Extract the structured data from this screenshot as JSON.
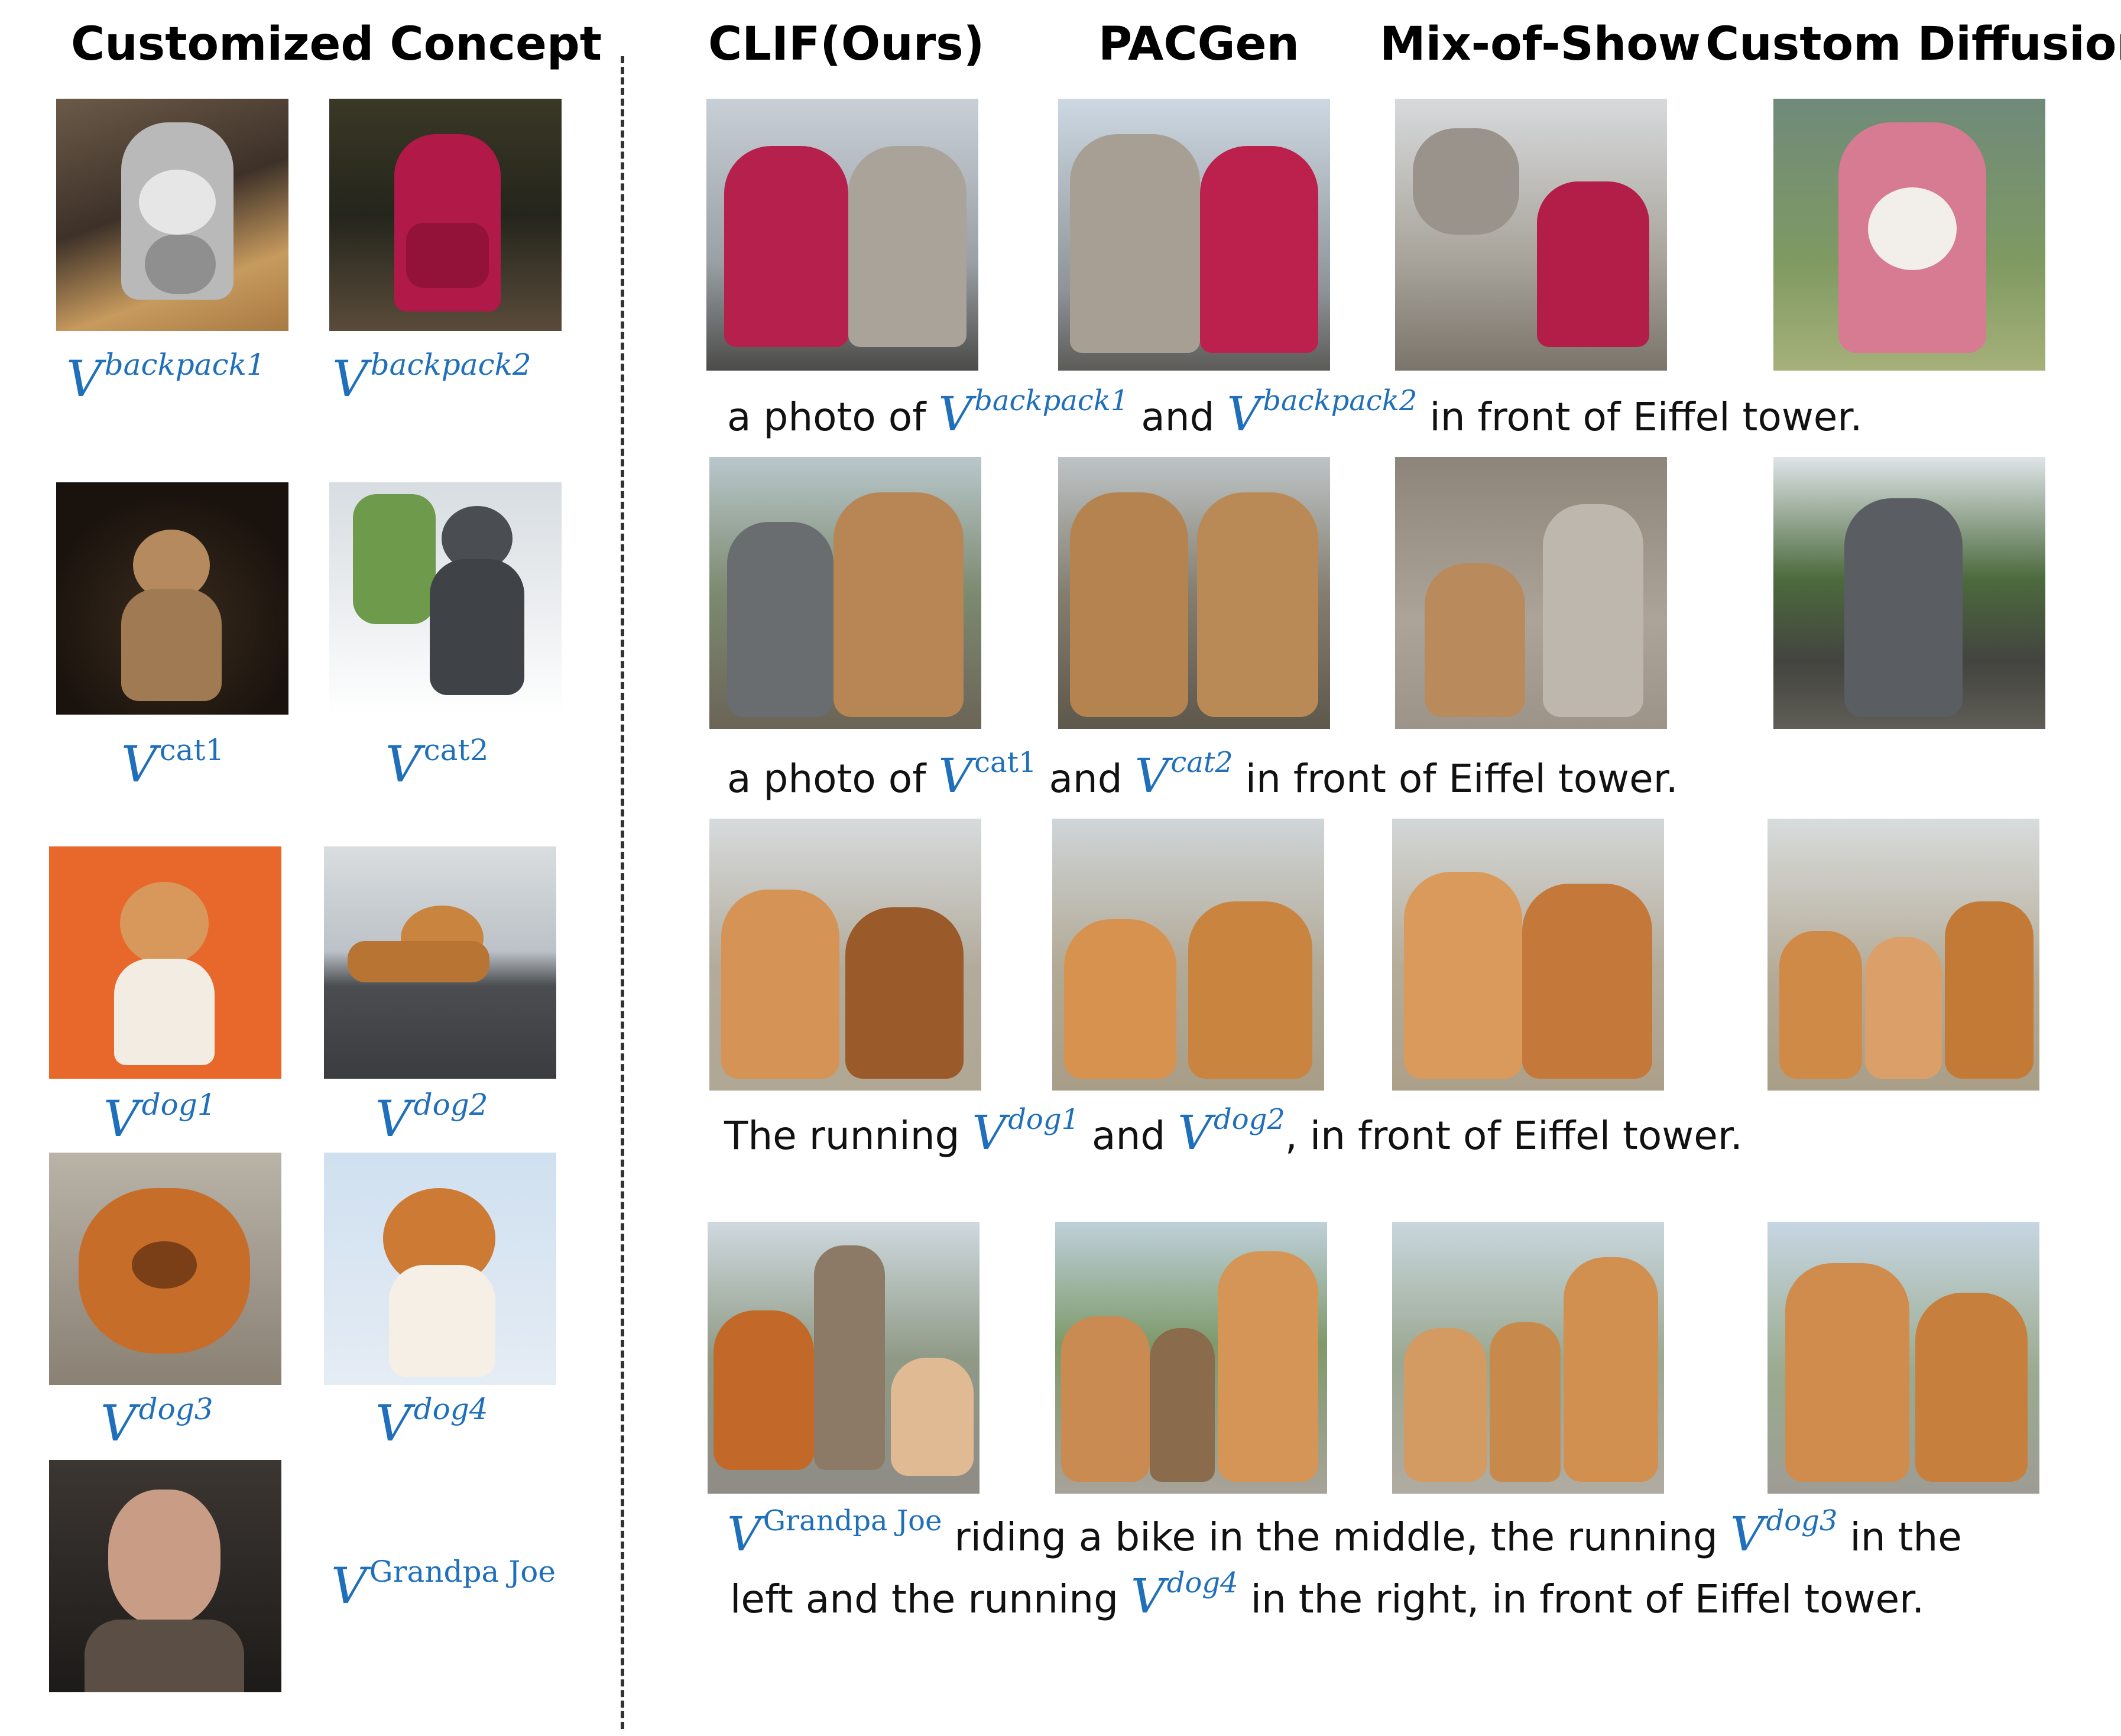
{
  "headers": {
    "concept": "Customized Concept",
    "clif": "CLIF(Ours)",
    "pacgen": "PACGen",
    "mix": "Mix-of-Show",
    "custom": "Custom Diffusion"
  },
  "concepts": {
    "backpack1": "backpack1",
    "backpack2": "backpack2",
    "cat1": "cat1",
    "cat2": "cat2",
    "dog1": "dog1",
    "dog2": "dog2",
    "dog3": "dog3",
    "dog4": "dog4",
    "grandpa": "Grandpa Joe",
    "V": "V"
  },
  "captions": {
    "row1": {
      "pre": "a photo of ",
      "v1": "backpack1",
      "mid": " and ",
      "v2": "backpack2",
      "post": " in front of Eiffel tower."
    },
    "row2": {
      "pre": "a photo of ",
      "v1": "cat1",
      "mid": " and ",
      "v2": "cat2",
      "post": " in front of Eiffel tower."
    },
    "row3": {
      "pre": "The running ",
      "v1": "dog1",
      "mid": " and ",
      "v2": "dog2",
      "post": ", in front of Eiffel tower."
    },
    "row4a": {
      "v1": "Grandpa Joe",
      "mid": " riding a bike in the middle, the running ",
      "v2": "dog3",
      "post": " in the"
    },
    "row4b": {
      "pre": "left and the running ",
      "v1": "dog4",
      "post": " in the right, in front of Eiffel tower."
    }
  },
  "colors": {
    "variable": "#1f6fba",
    "divider": "#333333"
  }
}
